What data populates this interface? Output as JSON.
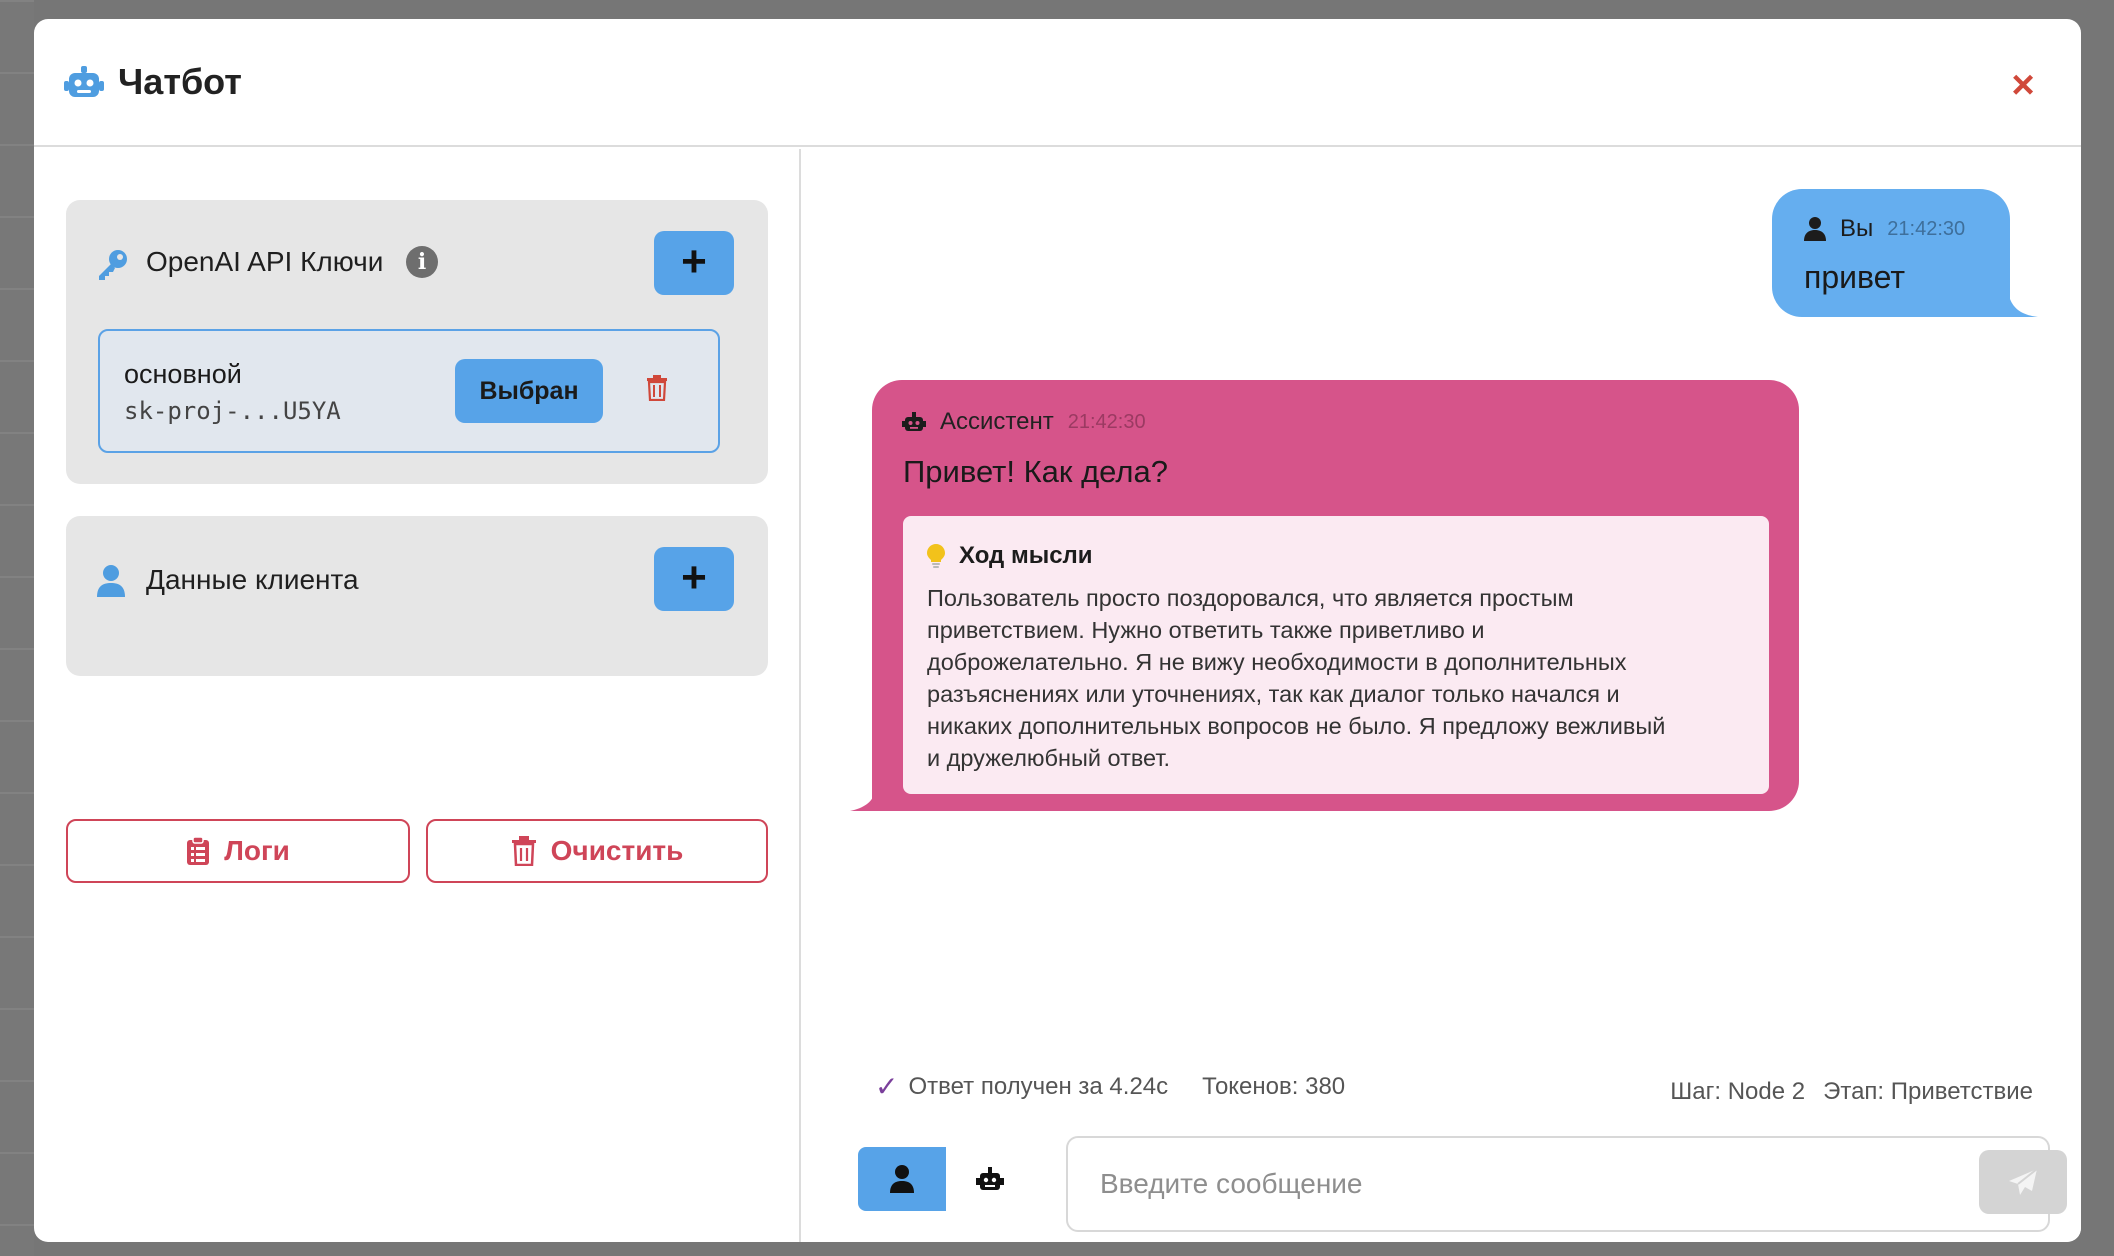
{
  "modal": {
    "title": "Чатбот",
    "close_label": "×"
  },
  "sidebar": {
    "api_keys": {
      "title": "OpenAI API Ключи",
      "info": "i",
      "add_label": "+",
      "items": [
        {
          "name": "основной",
          "value": "sk-proj-...U5YA",
          "status_label": "Выбран"
        }
      ]
    },
    "client": {
      "title": "Данные клиента",
      "add_label": "+"
    },
    "logs_label": "Логи",
    "clear_label": "Очистить"
  },
  "chat": {
    "messages": [
      {
        "role": "user",
        "sender": "Вы",
        "time": "21:42:30",
        "text": "привет"
      },
      {
        "role": "assistant",
        "sender": "Ассистент",
        "time": "21:42:30",
        "text": "Привет! Как дела?",
        "thought_title": "Ход мысли",
        "thought_lines": [
          "Пользователь просто поздоровался, что является простым",
          "приветствием. Нужно ответить также приветливо и",
          "доброжелательно. Я не вижу необходимости в дополнительных",
          "разъяснениях или уточнениях, так как диалог только начался и",
          "никаких дополнительных вопросов не было. Я предложу вежливый",
          "и дружелюбный ответ."
        ]
      }
    ],
    "status": {
      "response_time": "Ответ получен за 4.24с",
      "tokens": "Токенов: 380",
      "step": "Шаг: Node 2",
      "stage": "Этап: Приветствие"
    },
    "input": {
      "placeholder": "Введите сообщение",
      "value": ""
    }
  },
  "colors": {
    "accent_blue": "#57a3e8",
    "user_bubble": "#65aeef",
    "assistant_bubble": "#d6548a",
    "thought_bg": "#fbeaf2",
    "danger": "#cf4558"
  }
}
